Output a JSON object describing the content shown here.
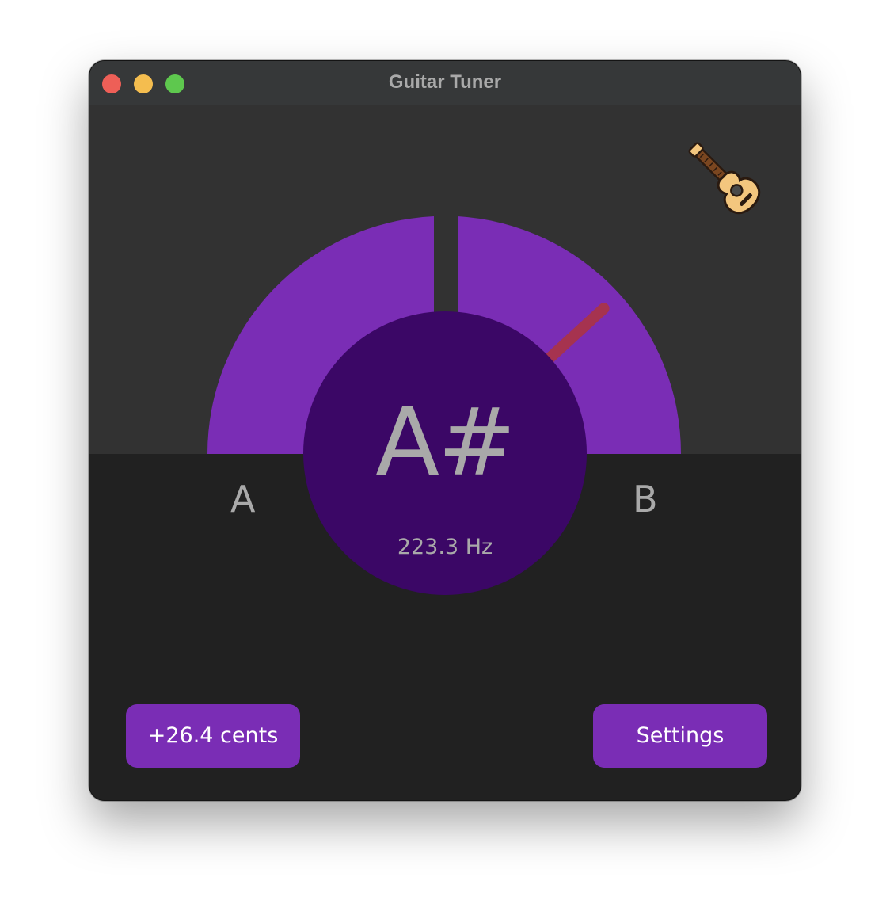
{
  "window": {
    "title": "Guitar Tuner"
  },
  "tuner": {
    "detected_note": "A#",
    "frequency": "223.3 Hz",
    "lower_note": "A",
    "upper_note": "B",
    "cents_offset": 26.4,
    "needle_color": "#a6334f",
    "gauge_color": "#7a2db5",
    "center_color": "#3b0766"
  },
  "buttons": {
    "cents_label": "+26.4 cents",
    "settings_label": "Settings"
  },
  "icons": {
    "app_icon": "acoustic-guitar-icon"
  }
}
